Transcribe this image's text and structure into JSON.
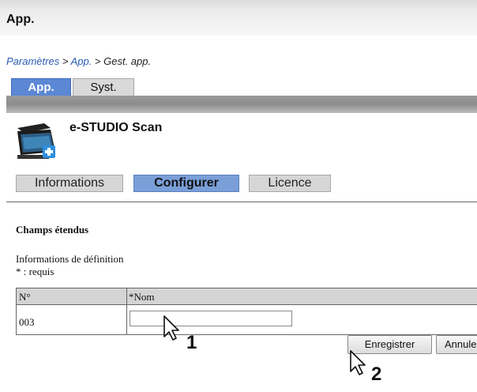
{
  "header": {
    "title": "App."
  },
  "breadcrumb": {
    "item1": "Paramètres",
    "sep1": " > ",
    "item2": "App.",
    "sep2": " > ",
    "item3": "Gest. app."
  },
  "tabs": [
    {
      "label": "App.",
      "active": true
    },
    {
      "label": "Syst.",
      "active": false
    }
  ],
  "app": {
    "name": "e-STUDIO Scan",
    "icon": "scanner-plus-icon"
  },
  "subtabs": [
    {
      "label": "Informations",
      "active": false
    },
    {
      "label": "Configurer",
      "active": true
    },
    {
      "label": "Licence",
      "active": false
    }
  ],
  "section": {
    "title": "Champs étendus",
    "definition_label": "Informations de définition",
    "required_note": "* : requis"
  },
  "table": {
    "columns": [
      "N°",
      "*Nom"
    ],
    "rows": [
      {
        "number": "003",
        "name_value": ""
      }
    ]
  },
  "buttons": {
    "save": "Enregistrer",
    "cancel": "Annuler"
  },
  "callouts": {
    "one": "1",
    "two": "2"
  },
  "colors": {
    "accent": "#5b87d4",
    "active_subtab": "#7a9fd8"
  }
}
